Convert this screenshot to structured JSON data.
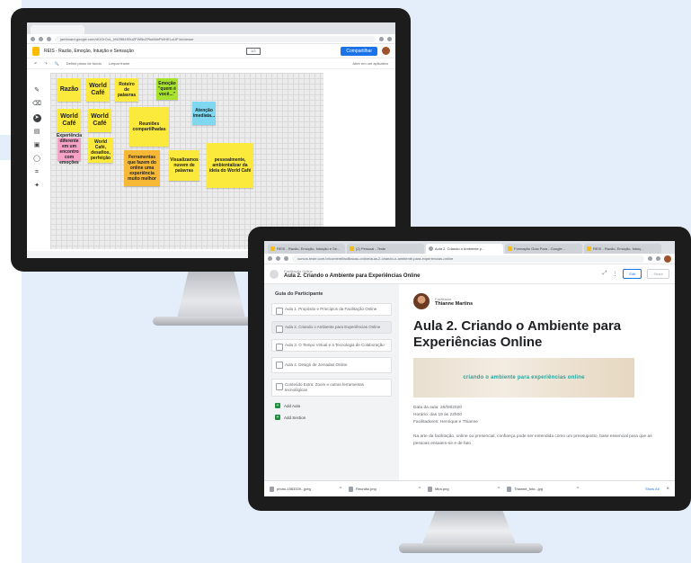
{
  "colors": {
    "background_panel": "#e4eefb",
    "sticky_yellow": "#fbe93b",
    "sticky_orange": "#f7b935",
    "sticky_pink": "#f4a3c6",
    "sticky_green": "#a6e22e",
    "sticky_cyan": "#7fd8f0",
    "accent_blue": "#1a73e8",
    "banner_text": "#2aa198"
  },
  "monitor1": {
    "url": "jamboard.google.com/d/1OrOcL_bN2B84S5uZFWBvZPkd4kbFWHELzLtF4o/viewer",
    "app_title": "REIS - Razão, Emoção, Intuição e Sensação",
    "frame_indicator": "1/2",
    "share_label": "Compartilhar",
    "toolbar": {
      "undo": "↶",
      "redo": "↷",
      "zoom": "🔍",
      "set_background": "Definir plano de fundo",
      "clear_frame": "Limpar frame",
      "right": "Abrir em um aplicativo"
    },
    "side_tools": [
      "✎",
      "⌫",
      "➤",
      "▤",
      "▣",
      "◯",
      "⌗",
      "✦"
    ],
    "stickies": [
      {
        "text": "Razão",
        "color": "#fbe93b",
        "big": true
      },
      {
        "text": "World Café",
        "color": "#fbe93b",
        "big": true
      },
      {
        "text": "Roteiro de palavras",
        "color": "#fbe93b",
        "big": false
      },
      {
        "text": "Emoção \"quem é você...\"",
        "color": "#a6e22e",
        "big": false
      },
      {
        "text": "World Café",
        "color": "#fbe93b",
        "big": true
      },
      {
        "text": "World Café",
        "color": "#fbe93b",
        "big": true
      },
      {
        "text": "Reuniões compartilhadas",
        "color": "#fbe93b",
        "big": false
      },
      {
        "text": "Atenção imediata...",
        "color": "#7fd8f0",
        "big": false
      },
      {
        "text": "Experiência diferente em um encontro com emoções",
        "color": "#f4a3c6",
        "big": false
      },
      {
        "text": "World Café, desafios, perfeição",
        "color": "#fbe93b",
        "big": false
      },
      {
        "text": "Ferramentas que fazem do online uma experiência muito melhor",
        "color": "#f7b935",
        "big": false
      },
      {
        "text": "Visualizamos nuvem de palavras",
        "color": "#fbe93b",
        "big": false
      },
      {
        "text": "pessoalmente, ambientalizar da ideia do World Café",
        "color": "#fbe93b",
        "big": false
      }
    ]
  },
  "monitor2": {
    "tabs": [
      "REIS - Razão, Emoção, Intuição e Se...",
      "(2) Pessoal - Teste",
      "Aula 2. Criando o Ambiente p...",
      "Formação Guia Para - Google...",
      "REIS - Razão, Emoção, Intuiç..."
    ],
    "url": "cursos.teste.com.br/content/facilitacao-online/aula-2-criando-o-ambiente-para-experiencias-online",
    "header": {
      "kicker": "Facilitação Online",
      "title": "Aula 2. Criando o Ambiente para Experiências Online",
      "edit_label": "Edit",
      "share_label": "Share"
    },
    "sidebar": {
      "heading": "Guia do Participante",
      "items": [
        "Aula 1. Propósito e Princípios da Facilitação Online",
        "Aula 2. Criando o Ambiente para Experiências Online",
        "Aula 3. O Tempo Virtual e a Tecnologia de Colaboração",
        "Aula 4. Design de Jornadas Online",
        "Conteúdo Extra: Zoom e outras ferramentas tecnológicas"
      ],
      "add_aula": "Add Aula",
      "add_section": "Add Section"
    },
    "content": {
      "facilitator_role": "Facilitador",
      "facilitator_name": "Thianne Martins",
      "lesson_title": "Aula 2. Criando o Ambiente para Experiências Online",
      "banner_text": "criando o ambiente para experiências online",
      "date_line": "Data da aula: 26/08/2020",
      "time_line": "Horário: das 19 às 22h00",
      "facilitators_line": "Facilitadores: Henrique e Thianne",
      "paragraph": "Na arte da facilitação, online ou presencial, confiança pode ser entendida como um pressuposto, base essencial para que as pessoas ensaiem-se e de fato"
    },
    "downloads": [
      "photo-1583339...jpeg",
      "Reunião.png",
      "Mira.png",
      "Thianne_foto...jpg"
    ],
    "show_all": "Show All"
  }
}
